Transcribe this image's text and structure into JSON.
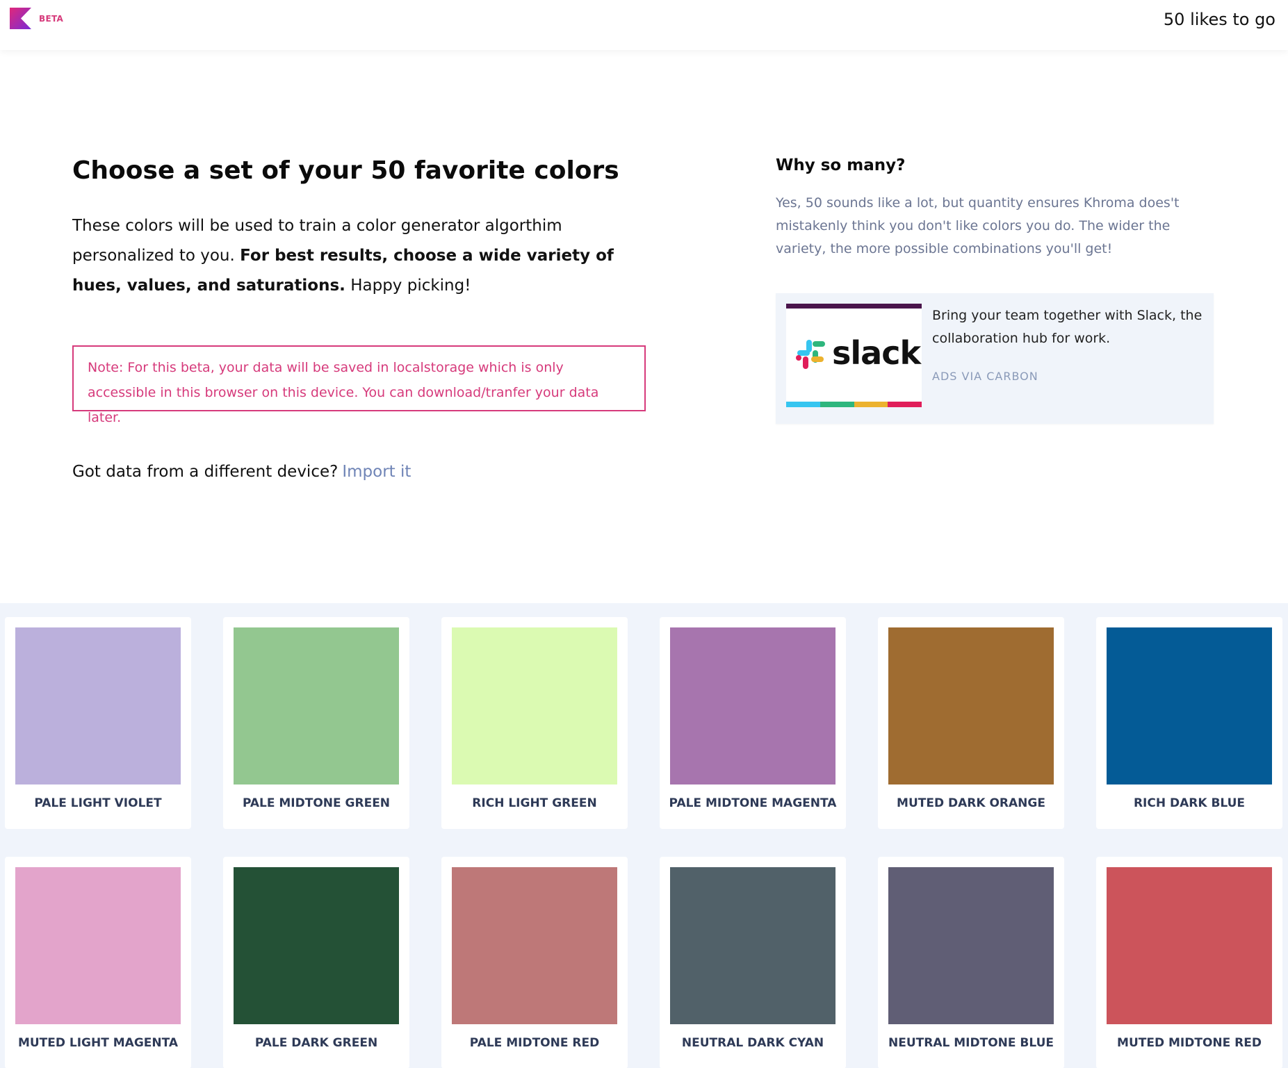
{
  "header": {
    "logo_icon": "khroma-k-logo",
    "beta_label": "BETA",
    "likes_remaining": "50 likes to go"
  },
  "intro": {
    "heading": "Choose a set of your 50 favorite colors",
    "text_part1": "These colors will be used to train a color generator algorthim personalized to you.",
    "text_bold": "For best results, choose a wide variety of hues, values, and saturations.",
    "text_part2": "Happy picking!",
    "note": "Note: For this beta, your data will be saved in localstorage which is only accessible in this browser on this device. You can download/tranfer your data later.",
    "import_prompt": "Got data from a different device?",
    "import_link": "Import it"
  },
  "why": {
    "title": "Why so many?",
    "text": "Yes, 50 sounds like a lot, but quantity ensures Khroma does't mistakenly think you don't like colors you do. The wider the variety, the more possible combinations you'll get!"
  },
  "ad": {
    "brand_word": "slack",
    "text": "Bring your team together with Slack, the collaboration hub for work.",
    "via": "ADS VIA CARBON",
    "bar_colors": [
      "#36c5f0",
      "#2eb67d",
      "#ecb22e",
      "#e01e5a"
    ]
  },
  "colors": [
    {
      "name": "PALE LIGHT VIOLET",
      "hex": "#bbb0dc"
    },
    {
      "name": "PALE MIDTONE GREEN",
      "hex": "#93c790"
    },
    {
      "name": "RICH LIGHT GREEN",
      "hex": "#dbfab2"
    },
    {
      "name": "PALE MIDTONE MAGENTA",
      "hex": "#a775ae"
    },
    {
      "name": "MUTED DARK ORANGE",
      "hex": "#9f6c31"
    },
    {
      "name": "RICH DARK BLUE",
      "hex": "#045b96"
    },
    {
      "name": "MUTED LIGHT MAGENTA",
      "hex": "#e3a4cb"
    },
    {
      "name": "PALE DARK GREEN",
      "hex": "#245136"
    },
    {
      "name": "PALE MIDTONE RED",
      "hex": "#be7878"
    },
    {
      "name": "NEUTRAL DARK CYAN",
      "hex": "#516169"
    },
    {
      "name": "NEUTRAL MIDTONE BLUE",
      "hex": "#605e75"
    },
    {
      "name": "MUTED MIDTONE RED",
      "hex": "#cc545b"
    }
  ]
}
